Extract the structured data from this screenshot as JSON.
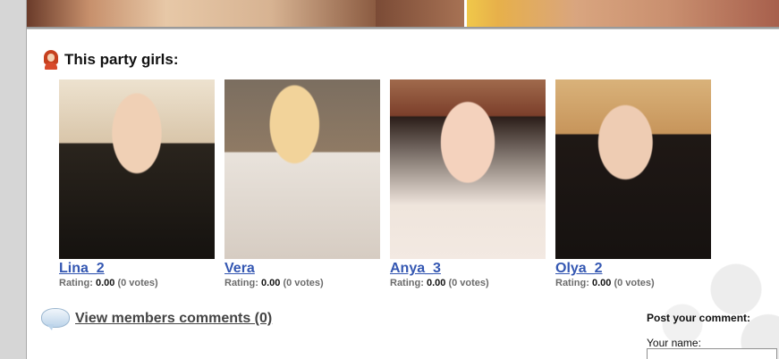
{
  "section": {
    "title": "This party girls:"
  },
  "girls": [
    {
      "name": "Lina_2",
      "rating_label": "Rating:",
      "rating_value": "0.00",
      "votes": "(0 votes)"
    },
    {
      "name": "Vera",
      "rating_label": "Rating:",
      "rating_value": "0.00",
      "votes": "(0 votes)"
    },
    {
      "name": "Anya_3",
      "rating_label": "Rating:",
      "rating_value": "0.00",
      "votes": "(0 votes)"
    },
    {
      "name": "Olya_2",
      "rating_label": "Rating:",
      "rating_value": "0.00",
      "votes": "(0 votes)"
    }
  ],
  "comments": {
    "link_text": "View members comments (0)"
  },
  "post_comment": {
    "title": "Post your comment:",
    "name_label": "Your name:",
    "name_value": ""
  },
  "icons": {
    "section": "girl-icon",
    "comments": "speech-bubble-icon"
  },
  "colors": {
    "link": "#3457b2",
    "rating_gray": "#6b6b6b",
    "rail": "#d6d6d6"
  }
}
